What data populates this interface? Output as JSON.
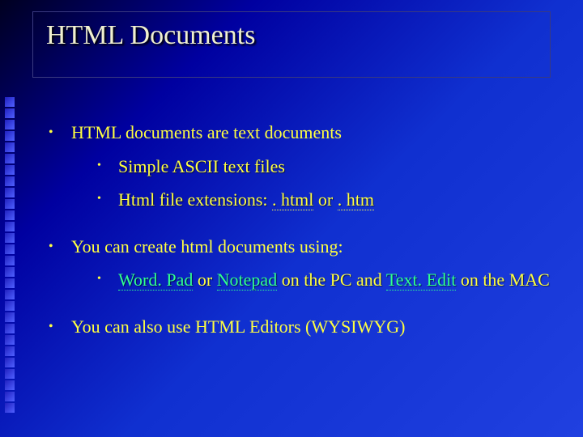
{
  "title": "HTML Documents",
  "bullets": [
    {
      "text": "HTML documents are text documents",
      "children": [
        {
          "text": "Simple ASCII text files"
        },
        {
          "prefix": "Html file extensions: ",
          "u1": ". html",
          "mid": " or ",
          "u2": ". htm"
        }
      ]
    },
    {
      "text": "You can create html documents using:",
      "children": [
        {
          "g1": "Word. Pad",
          "t1": " or ",
          "g2": "Notepad",
          "t2": " on the PC and ",
          "g3": "Text. Edit",
          "t3": " on the MAC"
        }
      ]
    },
    {
      "text": "You can also use HTML Editors (WYSIWYG)"
    }
  ]
}
